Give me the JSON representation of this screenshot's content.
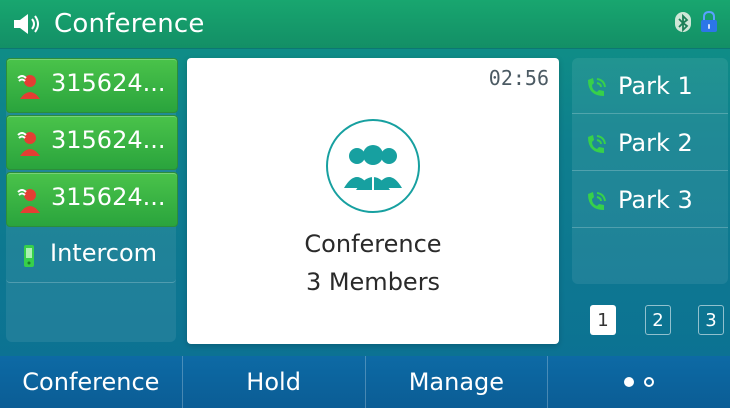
{
  "topbar": {
    "title": "Conference",
    "icons": [
      "speaker-icon",
      "bluetooth-icon",
      "lock-icon"
    ]
  },
  "left_lines": [
    {
      "label": "315624...",
      "icon": "hold-call-icon",
      "state": "active"
    },
    {
      "label": "315624...",
      "icon": "hold-call-icon",
      "state": "active"
    },
    {
      "label": "315624...",
      "icon": "hold-call-icon",
      "state": "active"
    },
    {
      "label": "Intercom",
      "icon": "intercom-icon",
      "state": "idle"
    },
    {
      "label": "",
      "icon": "",
      "state": "empty"
    }
  ],
  "center": {
    "timer": "02:56",
    "title": "Conference",
    "subtitle": "3 Members",
    "icon": "group-icon"
  },
  "right_lines": [
    {
      "label": "Park 1",
      "icon": "park-call-icon"
    },
    {
      "label": "Park 2",
      "icon": "park-call-icon"
    },
    {
      "label": "Park 3",
      "icon": "park-call-icon"
    },
    {
      "label": "",
      "icon": ""
    }
  ],
  "pager": {
    "pages": [
      "1",
      "2",
      "3"
    ],
    "active": "1"
  },
  "softkeys": {
    "conference": "Conference",
    "hold": "Hold",
    "manage": "Manage",
    "more": "more-icon"
  },
  "colors": {
    "active_line": "#2aa43d",
    "topbar": "#18a66f",
    "softkeys": "#0d6aa5",
    "accent_teal": "#17a0a0"
  }
}
